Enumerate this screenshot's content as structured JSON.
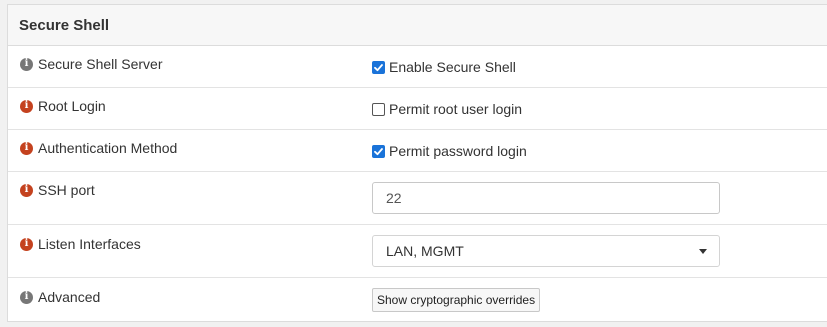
{
  "panel": {
    "title": "Secure Shell"
  },
  "rows": [
    {
      "label": "Secure Shell Server",
      "info_icon": "info-icon",
      "info_icon_color": "#777777",
      "control_type": "checkbox",
      "checked": true,
      "control_label": "Enable Secure Shell"
    },
    {
      "label": "Root Login",
      "info_icon": "info-icon",
      "info_icon_color": "#c4421f",
      "control_type": "checkbox",
      "checked": false,
      "control_label": "Permit root user login"
    },
    {
      "label": "Authentication Method",
      "info_icon": "info-icon",
      "info_icon_color": "#c4421f",
      "control_type": "checkbox",
      "checked": true,
      "control_label": "Permit password login"
    },
    {
      "label": "SSH port",
      "info_icon": "info-icon",
      "info_icon_color": "#c4421f",
      "control_type": "text-input",
      "value": "22"
    },
    {
      "label": "Listen Interfaces",
      "info_icon": "info-icon",
      "info_icon_color": "#c4421f",
      "control_type": "select",
      "selected_value": "LAN, MGMT"
    },
    {
      "label": "Advanced",
      "info_icon": "info-icon",
      "info_icon_color": "#777777",
      "control_type": "button",
      "button_label": "Show cryptographic overrides"
    }
  ],
  "icon_glyph": "i",
  "colors": {
    "checkbox_checked": "#1a73d9",
    "header_background": "#f7f7f7",
    "page_background": "#f1f1f1"
  }
}
